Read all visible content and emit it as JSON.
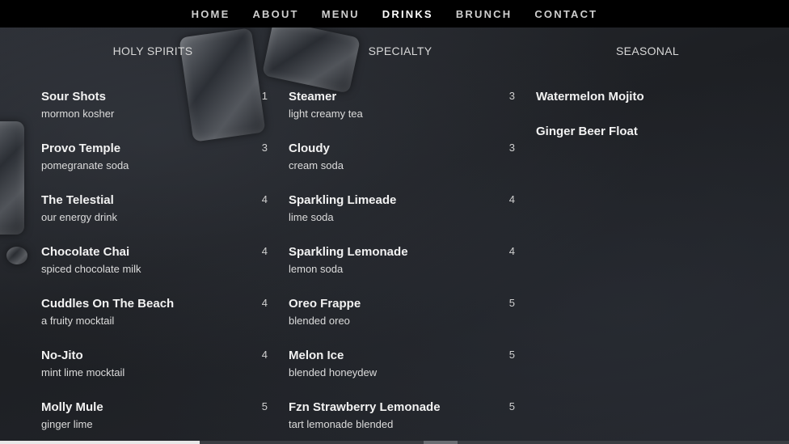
{
  "nav": {
    "items": [
      "HOME",
      "ABOUT",
      "MENU",
      "DRINKS",
      "BRUNCH",
      "CONTACT"
    ],
    "active": "DRINKS"
  },
  "columns": {
    "holy": {
      "title": "HOLY SPIRITS",
      "items": [
        {
          "name": "Sour Shots",
          "desc": "mormon kosher",
          "price": "1"
        },
        {
          "name": "Provo Temple",
          "desc": "pomegranate soda",
          "price": "3"
        },
        {
          "name": "The Telestial",
          "desc": "our energy drink",
          "price": "4"
        },
        {
          "name": "Chocolate Chai",
          "desc": "spiced chocolate milk",
          "price": "4"
        },
        {
          "name": "Cuddles On The Beach",
          "desc": "a fruity mocktail",
          "price": "4"
        },
        {
          "name": "No-Jito",
          "desc": "mint lime mocktail",
          "price": "4"
        },
        {
          "name": "Molly Mule",
          "desc": "ginger lime",
          "price": "5"
        }
      ]
    },
    "specialty": {
      "title": "SPECIALTY",
      "items": [
        {
          "name": "Steamer",
          "desc": "light creamy tea",
          "price": "3"
        },
        {
          "name": "Cloudy",
          "desc": "cream soda",
          "price": "3"
        },
        {
          "name": "Sparkling Limeade",
          "desc": "lime soda",
          "price": "4"
        },
        {
          "name": "Sparkling Lemonade",
          "desc": "lemon soda",
          "price": "4"
        },
        {
          "name": "Oreo Frappe",
          "desc": "blended oreo",
          "price": "5"
        },
        {
          "name": "Melon Ice",
          "desc": "blended honeydew",
          "price": "5"
        },
        {
          "name": "Fzn Strawberry Lemonade",
          "desc": "tart lemonade blended",
          "price": "5"
        }
      ]
    },
    "seasonal": {
      "title": "SEASONAL",
      "items": [
        {
          "name": "Watermelon Mojito"
        },
        {
          "name": "Ginger Beer Float"
        }
      ]
    }
  }
}
